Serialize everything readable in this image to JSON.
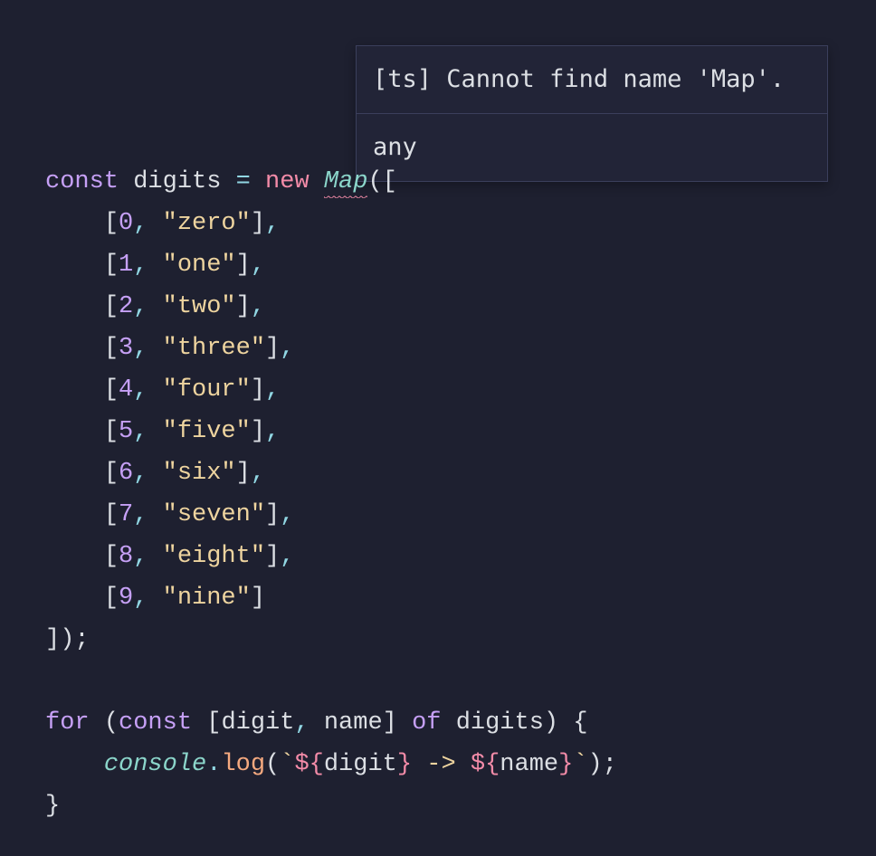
{
  "tooltip": {
    "error": "[ts] Cannot find name 'Map'.",
    "type": "any"
  },
  "code": {
    "kw_const1": "const",
    "v_digits": "digits",
    "op_assign": "=",
    "kw_new": "new",
    "class_map": "Map",
    "open_paren_bracket": "([",
    "entries": [
      {
        "num": "0",
        "str": "\"zero\""
      },
      {
        "num": "1",
        "str": "\"one\""
      },
      {
        "num": "2",
        "str": "\"two\""
      },
      {
        "num": "3",
        "str": "\"three\""
      },
      {
        "num": "4",
        "str": "\"four\""
      },
      {
        "num": "5",
        "str": "\"five\""
      },
      {
        "num": "6",
        "str": "\"six\""
      },
      {
        "num": "7",
        "str": "\"seven\""
      },
      {
        "num": "8",
        "str": "\"eight\""
      },
      {
        "num": "9",
        "str": "\"nine\""
      }
    ],
    "close_bracket_paren": "]);",
    "kw_for": "for",
    "kw_const2": "const",
    "destruct_open": "[",
    "v_digit": "digit",
    "v_name": "name",
    "destruct_close": "]",
    "kw_of": "of",
    "v_digits2": "digits",
    "body_open": "{",
    "obj_console": "console",
    "dot": ".",
    "fn_log": "log",
    "tmpl_open": "`",
    "tmpl_dopen": "${",
    "tmpl_mid": " -> ",
    "tmpl_dclose": "}",
    "tmpl_close": "`",
    "body_close": "}",
    "paren_open": "(",
    "paren_close": ")",
    "bracket_open": "[",
    "bracket_close": "]",
    "comma": ",",
    "semi": ";",
    "space": " ",
    "indent1": "    ",
    "indent2": "        "
  }
}
